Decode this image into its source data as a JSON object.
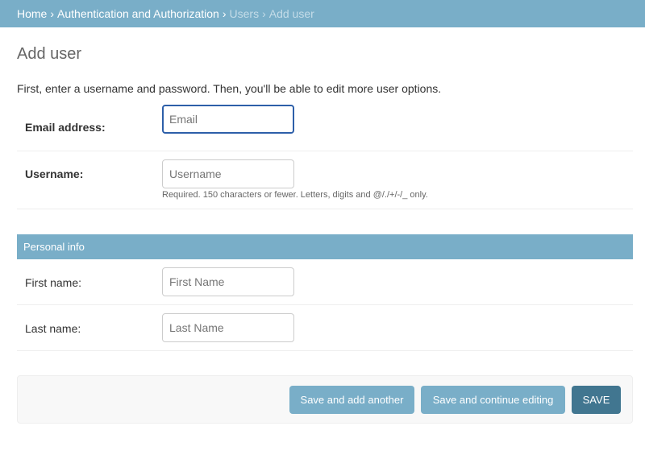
{
  "breadcrumbs": {
    "home": "Home",
    "app": "Authentication and Authorization",
    "model": "Users",
    "current": "Add user",
    "separator": "›"
  },
  "page": {
    "title": "Add user",
    "intro": "First, enter a username and password. Then, you'll be able to edit more user options."
  },
  "fields": {
    "email": {
      "label": "Email address:",
      "placeholder": "Email",
      "value": ""
    },
    "username": {
      "label": "Username:",
      "placeholder": "Username",
      "value": "",
      "help": "Required. 150 characters or fewer. Letters, digits and @/./+/-/_ only."
    }
  },
  "personal_info": {
    "title": "Personal info",
    "first_name": {
      "label": "First name:",
      "placeholder": "First Name",
      "value": ""
    },
    "last_name": {
      "label": "Last name:",
      "placeholder": "Last Name",
      "value": ""
    }
  },
  "submit": {
    "save_add_another": "Save and add another",
    "save_continue": "Save and continue editing",
    "save": "SAVE"
  },
  "colors": {
    "header_bg": "#79aec8",
    "primary_button": "#417690",
    "secondary_button": "#79aec8",
    "focus_border": "#2d5fa9"
  }
}
